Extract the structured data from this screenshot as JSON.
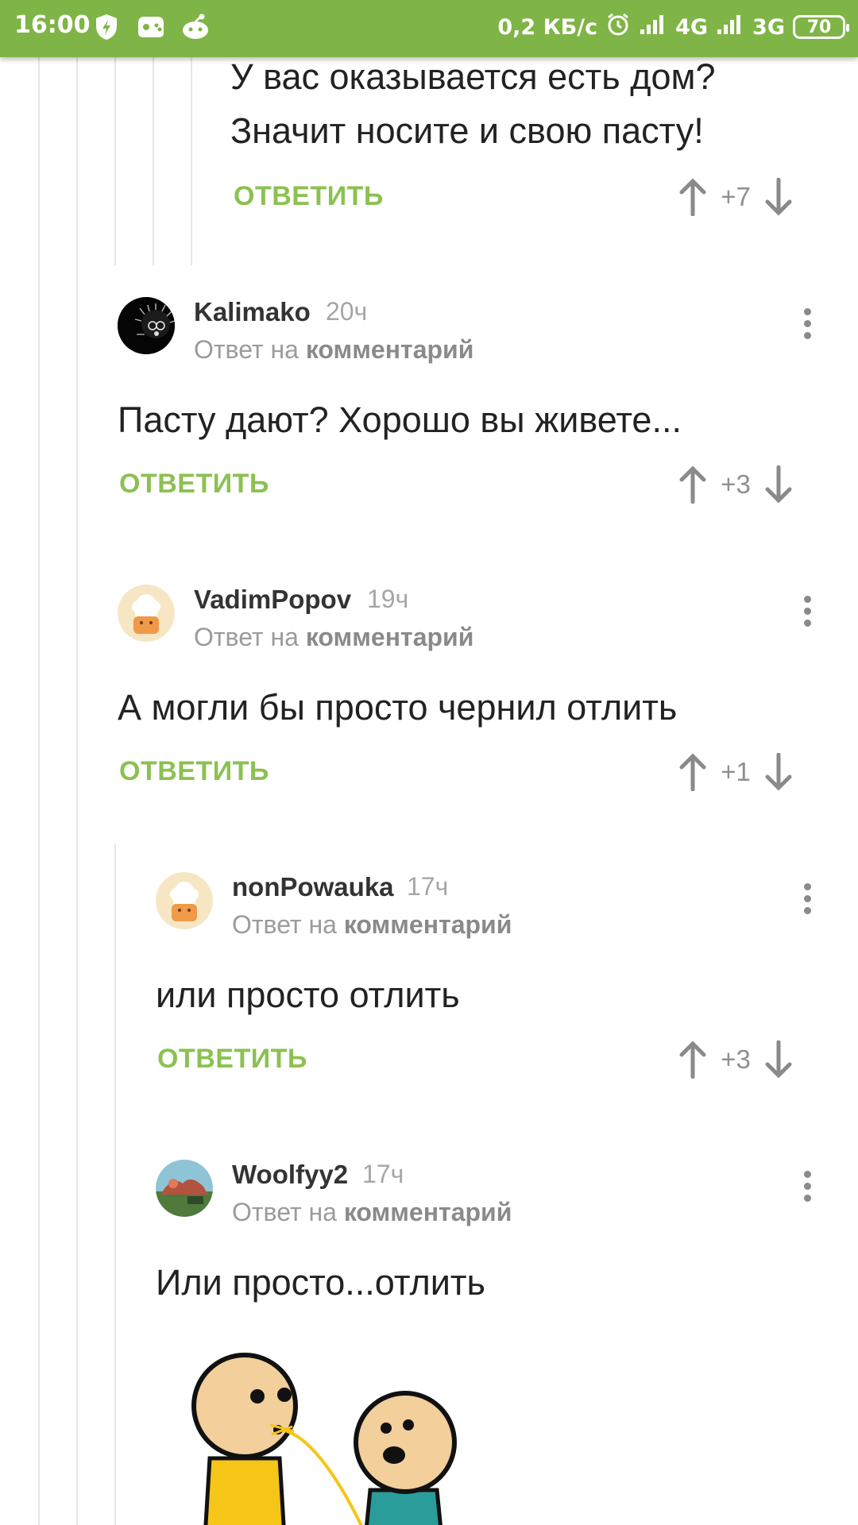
{
  "status_bar": {
    "time": "16:00",
    "net_speed": "0,2 КБ/с",
    "network1": "4G",
    "network2": "3G",
    "battery": "70"
  },
  "comments": [
    {
      "body_lines": [
        "У вас оказывается есть дом?",
        "Значит носите и свою пасту!"
      ],
      "reply_label": "ОТВЕТИТЬ",
      "score": "+7"
    },
    {
      "username": "Kalimako",
      "time": "20ч",
      "reply_prefix": "Ответ на",
      "reply_target": "комментарий",
      "body": "Пасту дают? Хорошо вы живете...",
      "reply_label": "ОТВЕТИТЬ",
      "score": "+3"
    },
    {
      "username": "VadimPopov",
      "time": "19ч",
      "reply_prefix": "Ответ на",
      "reply_target": "комментарий",
      "body": "А могли бы просто чернил отлить",
      "reply_label": "ОТВЕТИТЬ",
      "score": "+1"
    },
    {
      "username": "nonPowauka",
      "time": "17ч",
      "reply_prefix": "Ответ на",
      "reply_target": "комментарий",
      "body": "или просто отлить",
      "reply_label": "ОТВЕТИТЬ",
      "score": "+3"
    },
    {
      "username": "Woolfyy2",
      "time": "17ч",
      "reply_prefix": "Ответ на",
      "reply_target": "комментарий",
      "body": "Или просто...отлить"
    }
  ],
  "colors": {
    "status_bar": "#7fb446",
    "accent_green": "#8cc152",
    "text": "#222222",
    "muted": "#9b9b9b"
  }
}
